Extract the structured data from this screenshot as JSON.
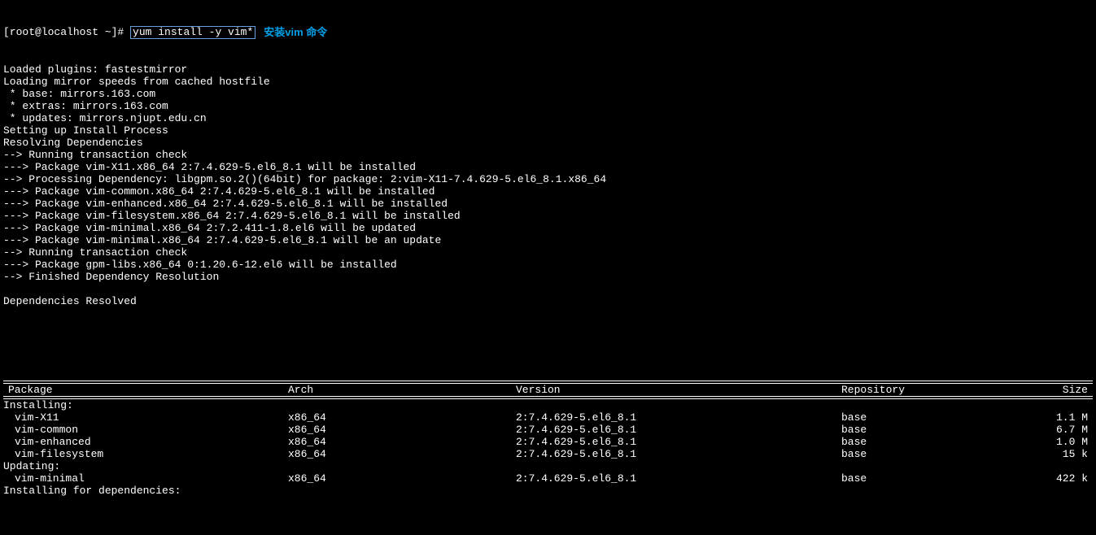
{
  "prompt": "[root@localhost ~]# ",
  "command": "yum install -y vim*",
  "annotation": "安装vim 命令",
  "prelines": [
    "Loaded plugins: fastestmirror",
    "Loading mirror speeds from cached hostfile",
    " * base: mirrors.163.com",
    " * extras: mirrors.163.com",
    " * updates: mirrors.njupt.edu.cn",
    "Setting up Install Process",
    "Resolving Dependencies",
    "--> Running transaction check",
    "---> Package vim-X11.x86_64 2:7.4.629-5.el6_8.1 will be installed",
    "--> Processing Dependency: libgpm.so.2()(64bit) for package: 2:vim-X11-7.4.629-5.el6_8.1.x86_64",
    "---> Package vim-common.x86_64 2:7.4.629-5.el6_8.1 will be installed",
    "---> Package vim-enhanced.x86_64 2:7.4.629-5.el6_8.1 will be installed",
    "---> Package vim-filesystem.x86_64 2:7.4.629-5.el6_8.1 will be installed",
    "---> Package vim-minimal.x86_64 2:7.2.411-1.8.el6 will be updated",
    "---> Package vim-minimal.x86_64 2:7.4.629-5.el6_8.1 will be an update",
    "--> Running transaction check",
    "---> Package gpm-libs.x86_64 0:1.20.6-12.el6 will be installed",
    "--> Finished Dependency Resolution",
    "",
    "Dependencies Resolved",
    ""
  ],
  "headers": {
    "pkg": "Package",
    "arch": "Arch",
    "ver": "Version",
    "repo": "Repository",
    "size": "Size"
  },
  "sections": {
    "installing": "Installing:",
    "updating": "Updating:",
    "installing_deps": "Installing for dependencies:"
  },
  "rows_installing": [
    {
      "pkg": "vim-X11",
      "arch": "x86_64",
      "ver": "2:7.4.629-5.el6_8.1",
      "repo": "base",
      "size": "1.1 M"
    },
    {
      "pkg": "vim-common",
      "arch": "x86_64",
      "ver": "2:7.4.629-5.el6_8.1",
      "repo": "base",
      "size": "6.7 M"
    },
    {
      "pkg": "vim-enhanced",
      "arch": "x86_64",
      "ver": "2:7.4.629-5.el6_8.1",
      "repo": "base",
      "size": "1.0 M"
    },
    {
      "pkg": "vim-filesystem",
      "arch": "x86_64",
      "ver": "2:7.4.629-5.el6_8.1",
      "repo": "base",
      "size": "15 k"
    }
  ],
  "rows_updating": [
    {
      "pkg": "vim-minimal",
      "arch": "x86_64",
      "ver": "2:7.4.629-5.el6_8.1",
      "repo": "base",
      "size": "422 k"
    }
  ]
}
